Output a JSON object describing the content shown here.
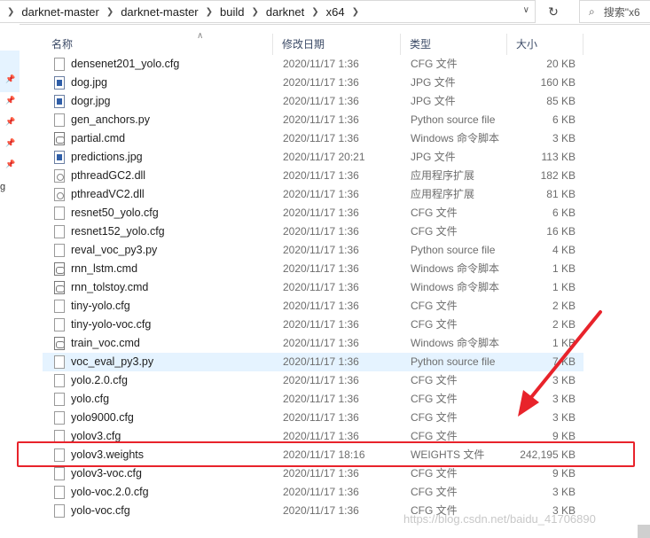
{
  "address_bar": {
    "crumbs": [
      "darknet-master",
      "darknet-master",
      "build",
      "darknet",
      "x64"
    ],
    "search_placeholder": "搜索\"x6"
  },
  "columns": {
    "name": "名称",
    "date": "修改日期",
    "type": "类型",
    "size": "大小"
  },
  "files": [
    {
      "name": "densenet201_yolo.cfg",
      "date": "2020/11/17 1:36",
      "type": "CFG 文件",
      "size": "20 KB",
      "icon": "file-icon"
    },
    {
      "name": "dog.jpg",
      "date": "2020/11/17 1:36",
      "type": "JPG 文件",
      "size": "160 KB",
      "icon": "image-icon"
    },
    {
      "name": "dogr.jpg",
      "date": "2020/11/17 1:36",
      "type": "JPG 文件",
      "size": "85 KB",
      "icon": "image-icon"
    },
    {
      "name": "gen_anchors.py",
      "date": "2020/11/17 1:36",
      "type": "Python source file",
      "size": "6 KB",
      "icon": "file-icon"
    },
    {
      "name": "partial.cmd",
      "date": "2020/11/17 1:36",
      "type": "Windows 命令脚本",
      "size": "3 KB",
      "icon": "cmd-icon"
    },
    {
      "name": "predictions.jpg",
      "date": "2020/11/17 20:21",
      "type": "JPG 文件",
      "size": "113 KB",
      "icon": "image-icon"
    },
    {
      "name": "pthreadGC2.dll",
      "date": "2020/11/17 1:36",
      "type": "应用程序扩展",
      "size": "182 KB",
      "icon": "dll-icon"
    },
    {
      "name": "pthreadVC2.dll",
      "date": "2020/11/17 1:36",
      "type": "应用程序扩展",
      "size": "81 KB",
      "icon": "dll-icon"
    },
    {
      "name": "resnet50_yolo.cfg",
      "date": "2020/11/17 1:36",
      "type": "CFG 文件",
      "size": "6 KB",
      "icon": "file-icon"
    },
    {
      "name": "resnet152_yolo.cfg",
      "date": "2020/11/17 1:36",
      "type": "CFG 文件",
      "size": "16 KB",
      "icon": "file-icon"
    },
    {
      "name": "reval_voc_py3.py",
      "date": "2020/11/17 1:36",
      "type": "Python source file",
      "size": "4 KB",
      "icon": "file-icon"
    },
    {
      "name": "rnn_lstm.cmd",
      "date": "2020/11/17 1:36",
      "type": "Windows 命令脚本",
      "size": "1 KB",
      "icon": "cmd-icon"
    },
    {
      "name": "rnn_tolstoy.cmd",
      "date": "2020/11/17 1:36",
      "type": "Windows 命令脚本",
      "size": "1 KB",
      "icon": "cmd-icon"
    },
    {
      "name": "tiny-yolo.cfg",
      "date": "2020/11/17 1:36",
      "type": "CFG 文件",
      "size": "2 KB",
      "icon": "file-icon"
    },
    {
      "name": "tiny-yolo-voc.cfg",
      "date": "2020/11/17 1:36",
      "type": "CFG 文件",
      "size": "2 KB",
      "icon": "file-icon"
    },
    {
      "name": "train_voc.cmd",
      "date": "2020/11/17 1:36",
      "type": "Windows 命令脚本",
      "size": "1 KB",
      "icon": "cmd-icon"
    },
    {
      "name": "voc_eval_py3.py",
      "date": "2020/11/17 1:36",
      "type": "Python source file",
      "size": "7 KB",
      "icon": "file-icon",
      "hover": true
    },
    {
      "name": "yolo.2.0.cfg",
      "date": "2020/11/17 1:36",
      "type": "CFG 文件",
      "size": "3 KB",
      "icon": "file-icon"
    },
    {
      "name": "yolo.cfg",
      "date": "2020/11/17 1:36",
      "type": "CFG 文件",
      "size": "3 KB",
      "icon": "file-icon"
    },
    {
      "name": "yolo9000.cfg",
      "date": "2020/11/17 1:36",
      "type": "CFG 文件",
      "size": "3 KB",
      "icon": "file-icon"
    },
    {
      "name": "yolov3.cfg",
      "date": "2020/11/17 1:36",
      "type": "CFG 文件",
      "size": "9 KB",
      "icon": "file-icon"
    },
    {
      "name": "yolov3.weights",
      "date": "2020/11/17 18:16",
      "type": "WEIGHTS 文件",
      "size": "242,195 KB",
      "icon": "file-icon",
      "highlighted": true
    },
    {
      "name": "yolov3-voc.cfg",
      "date": "2020/11/17 1:36",
      "type": "CFG 文件",
      "size": "9 KB",
      "icon": "file-icon"
    },
    {
      "name": "yolo-voc.2.0.cfg",
      "date": "2020/11/17 1:36",
      "type": "CFG 文件",
      "size": "3 KB",
      "icon": "file-icon"
    },
    {
      "name": "yolo-voc.cfg",
      "date": "2020/11/17 1:36",
      "type": "CFG 文件",
      "size": "3 KB",
      "icon": "file-icon"
    }
  ],
  "nav_partial_char": "g",
  "watermark": "https://blog.csdn.net/baidu_41706890",
  "colors": {
    "highlight_box": "#e8232b",
    "arrow": "#e8232b",
    "hover_row": "#e5f3ff",
    "header_text": "#3b4a66"
  }
}
